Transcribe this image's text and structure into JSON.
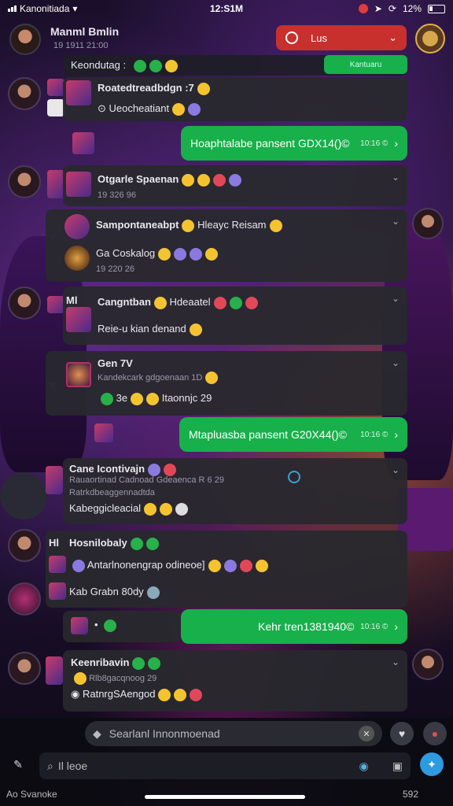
{
  "status": {
    "carrier": "Kanonitiada",
    "time": "12:S1M",
    "battery": "12%"
  },
  "header": {
    "name": "Manml Bmlin",
    "sub": "19 1911 21:00",
    "live_label": "Lus"
  },
  "top_line": {
    "text": "Keondutag :"
  },
  "top_green": {
    "text": "Kantuaru"
  },
  "messages": [
    {
      "line1": "Roatedtreadbdgn :7",
      "line2": "Ueocheatiant"
    },
    {
      "pill": "Hoaphtalabe pansent GDX14()©",
      "meta": "10:16 ©"
    },
    {
      "name": "Otgarle Spaenan",
      "date": "19 326 96"
    },
    {
      "name": "Sampontaneabpt",
      "extra": "Hleayc Reisam",
      "line2": "Ga Coskalog",
      "date": "19 220 26"
    },
    {
      "name": "Cangntban",
      "extra": "Hdeaatel",
      "line2": "Reie-u kian denand",
      "prefix": "Ml"
    },
    {
      "name": "Gen 7V",
      "line2": "Kandekcark gdgoenaan  1D",
      "line3": "3e",
      "line3b": "Itaonnjc 29"
    },
    {
      "pill": "Mtapluasba pansent G20X44()©",
      "meta": "10:16 ©"
    },
    {
      "name": "Cane Icontivajn",
      "line2": "Rauaortinad Cadnoad Gdeaenca",
      "line2b": "R 6 29",
      "line3": "Ratrkdbeaggennadtda",
      "line4": "Kabeggicleacial"
    },
    {
      "name": "Hosnilobaly",
      "line2": "Antarlnonengrap odineoe]",
      "line3": "Kab Grabn 80dy",
      "prefix": "Hl"
    },
    {
      "pill": "Kehr tren1381940©",
      "meta": "10:16 ©"
    },
    {
      "name": "Keenribavin",
      "line2": "Rlb8gacqnoog 29",
      "line3": "RatnrgSAengod"
    }
  ],
  "input": {
    "placeholder": "Searlanl Innonmoenad"
  },
  "search": {
    "placeholder": "Il leoe"
  },
  "footer": {
    "caption": "Ao Svanoke",
    "right": "592"
  },
  "colors": {
    "green": "#17b04a",
    "live": "#c8302e",
    "card": "#28282e"
  }
}
